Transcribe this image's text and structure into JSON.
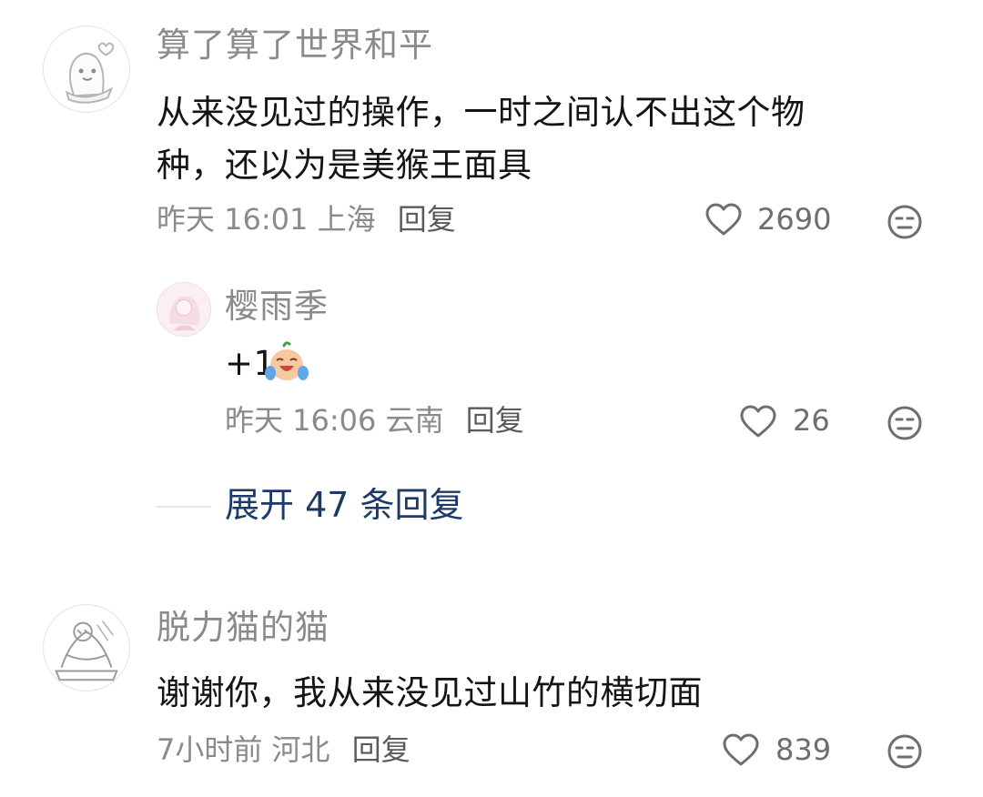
{
  "comments": [
    {
      "username": "算了算了世界和平",
      "content_line1": "从来没见过的操作，一时之间认不出这个物",
      "content_line2": "种，还以为是美猴王面具",
      "time": "昨天 16:01",
      "location": "上海",
      "reply_label": "回复",
      "likes": "2690"
    },
    {
      "username": "樱雨季",
      "content": "+1",
      "emoji": "crying-laughing-sticker",
      "time": "昨天 16:06",
      "location": "云南",
      "reply_label": "回复",
      "likes": "26"
    },
    {
      "username": "脱力猫的猫",
      "content": "谢谢你，我从来没见过山竹的横切面",
      "time": "7小时前",
      "location": "河北",
      "reply_label": "回复",
      "likes": "839"
    }
  ],
  "expand_replies": "展开 47 条回复",
  "icons": {
    "like": "heart-outline-icon",
    "dislike": "meh-face-icon"
  },
  "colors": {
    "username": "#8a8a8a",
    "content": "#141414",
    "expand_link": "#1d3a66",
    "meta": "#8a8a8a"
  }
}
